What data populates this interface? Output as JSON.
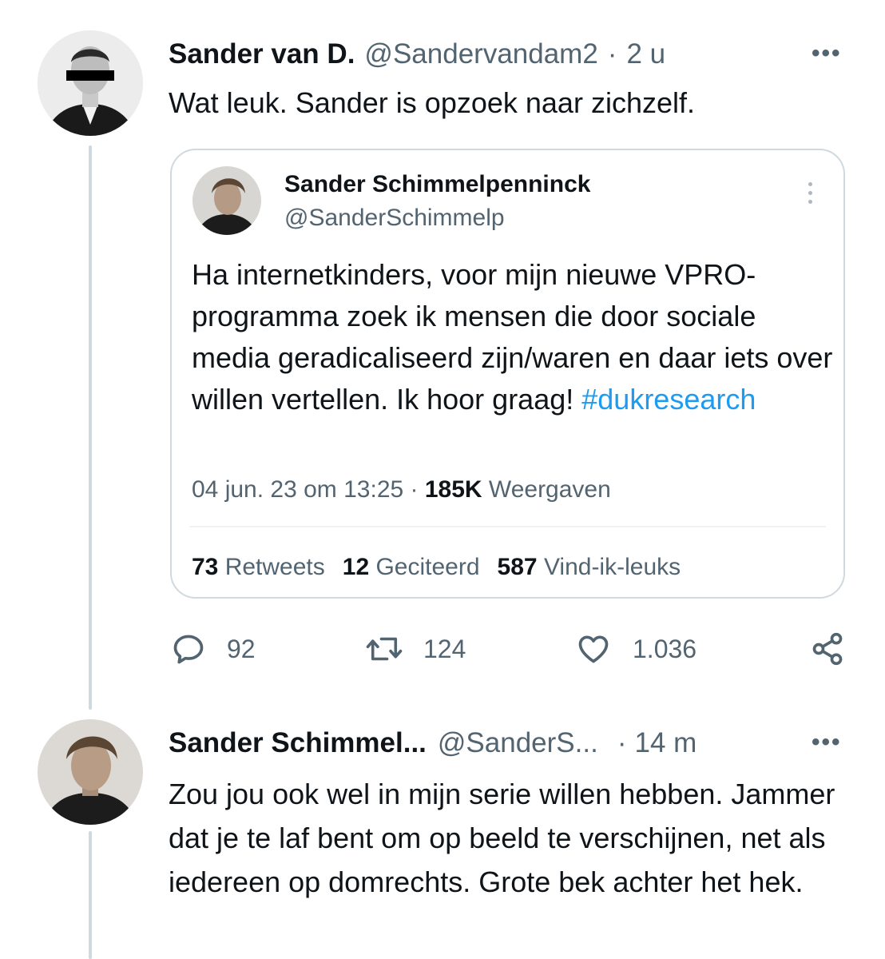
{
  "tweet1": {
    "name": "Sander van D.",
    "handle": "@Sandervandam2",
    "separator": "·",
    "time": "2 u",
    "more": "•••",
    "text": "Wat leuk. Sander is opzoek naar zichzelf.",
    "avatar_icon": "profile-photo-censored",
    "quoted": {
      "name": "Sander Schimmelpenninck",
      "handle": "@SanderSchimmelp",
      "text_before": "Ha internetkinders, voor mijn nieuwe VPRO-programma zoek ik mensen die door sociale media geradicaliseerd zijn/waren en daar iets over willen vertellen. Ik hoor graag! ",
      "hashtag": "#dukresearch",
      "date": "04 jun. 23 om 13:25",
      "meta_sep": " · ",
      "views_count": "185K",
      "views_label": " Weergaven",
      "retweets_count": "73",
      "retweets_label": " Retweets",
      "quotes_count": "12",
      "quotes_label": " Geciteerd",
      "likes_count": "587",
      "likes_label": " Vind-ik-leuks"
    },
    "actions": {
      "replies": "92",
      "retweets": "124",
      "likes": "1.036"
    }
  },
  "tweet2": {
    "name": "Sander Schimmel...",
    "handle": "@SanderS...",
    "separator": "·",
    "time": "14 m",
    "more": "•••",
    "text": "Zou jou ook wel in mijn serie willen hebben. Jammer dat je te laf bent om op beeld te verschijnen, net als iedereen op domrechts. Grote bek achter het hek."
  },
  "colors": {
    "text": "#0f1419",
    "secondary": "#536471",
    "link": "#1d9bf0",
    "border": "#cfd9de"
  }
}
